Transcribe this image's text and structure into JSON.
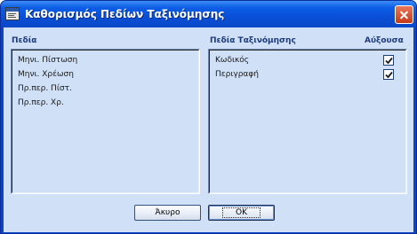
{
  "window": {
    "title": "Καθορισμός Πεδίων Ταξινόμησης"
  },
  "left_panel": {
    "header": "Πεδία",
    "items": [
      "Μηνι. Πίστωση",
      "Μηνι. Χρέωση",
      "Πρ.περ. Πίστ.",
      "Πρ.περ. Χρ."
    ]
  },
  "right_panel": {
    "header": "Πεδία Ταξινόμησης",
    "ascending_header": "Αύξουσα",
    "items": [
      {
        "label": "Κωδικός",
        "ascending": true
      },
      {
        "label": "Περιγραφή",
        "ascending": true
      }
    ]
  },
  "buttons": {
    "cancel": "Άκυρο",
    "ok": "OK"
  },
  "colors": {
    "title_bar": "#0a4fd8",
    "client_bg": "#cfe0f7",
    "header_text": "#1f3a7a",
    "close_button": "#c6391b"
  },
  "icons": {
    "app": "app-window-icon",
    "close": "close-icon",
    "check": "checkmark-icon"
  }
}
